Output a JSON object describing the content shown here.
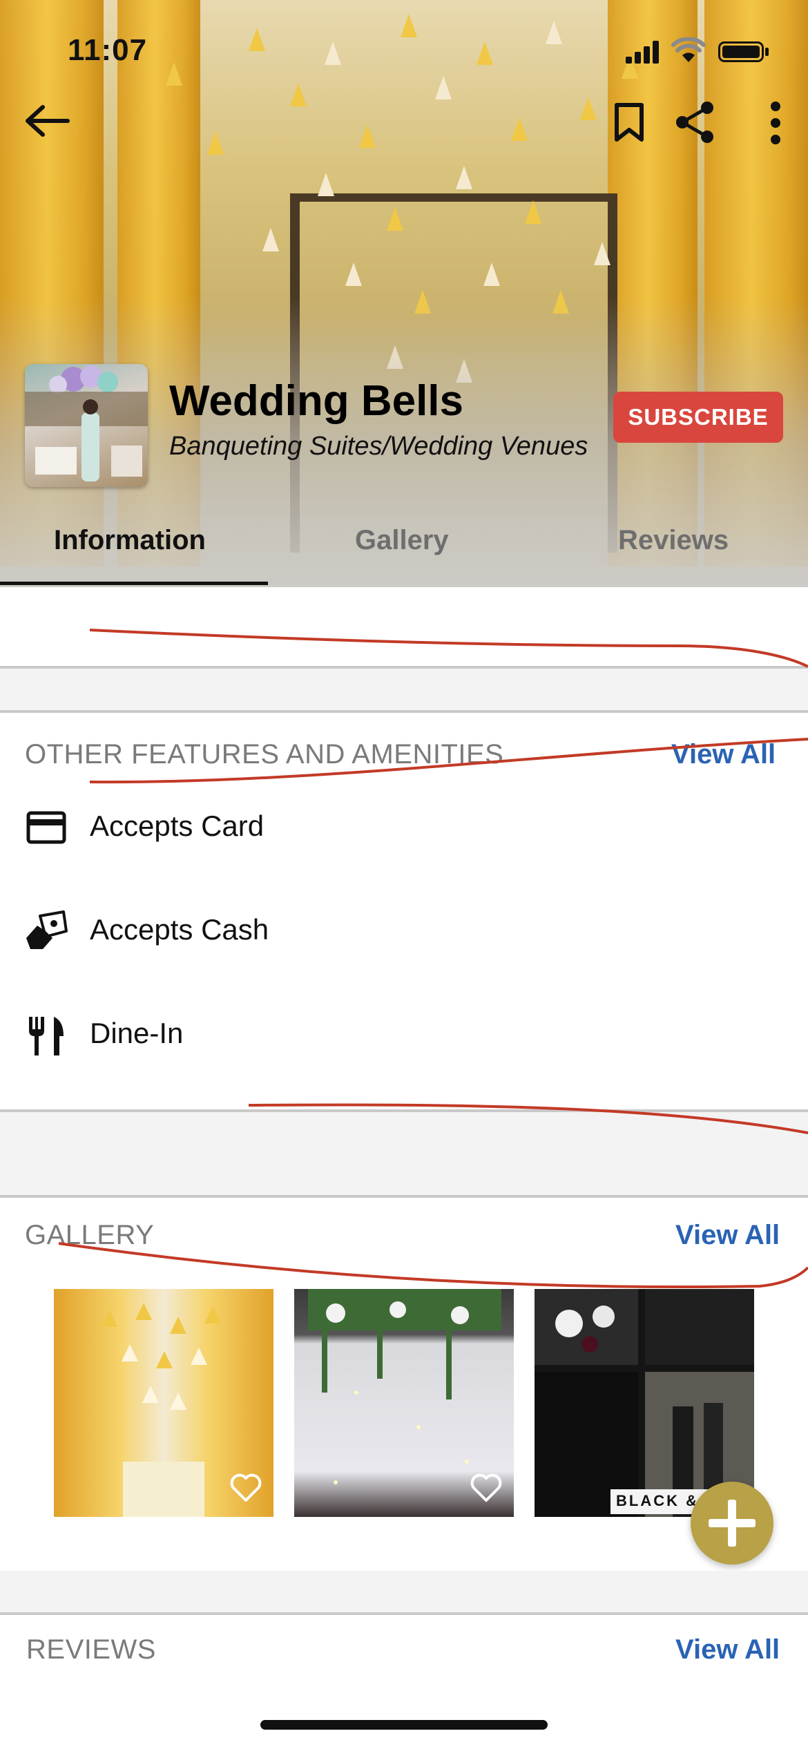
{
  "status_bar": {
    "time": "11:07"
  },
  "venue": {
    "name": "Wedding Bells",
    "category": "Banqueting Suites/Wedding Venues",
    "subscribe_label": "SUBSCRIBE"
  },
  "tabs": [
    {
      "label": "Information",
      "active": true
    },
    {
      "label": "Gallery",
      "active": false
    },
    {
      "label": "Reviews",
      "active": false
    }
  ],
  "amenities": {
    "title": "OTHER FEATURES AND AMENITIES",
    "view_all": "View All",
    "items": [
      {
        "label": "Accepts Card",
        "icon": "credit-card-icon"
      },
      {
        "label": "Accepts Cash",
        "icon": "cash-icon"
      },
      {
        "label": "Dine-In",
        "icon": "fork-knife-icon"
      }
    ]
  },
  "gallery": {
    "title": "GALLERY",
    "view_all": "View All",
    "items": [
      {
        "alt": "yellow curtains and hanging tassels"
      },
      {
        "alt": "white curtain backdrop with lights and greenery"
      },
      {
        "alt": "black and white wedding invitation collage",
        "caption": "BLACK &"
      }
    ]
  },
  "reviews": {
    "title": "REVIEWS",
    "view_all": "View All"
  },
  "colors": {
    "accent_blue": "#2a63b4",
    "subscribe_red": "#d9463d",
    "fab_gold": "#b8a147"
  }
}
